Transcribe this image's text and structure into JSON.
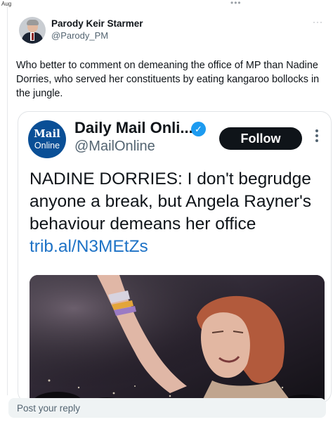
{
  "top_bar": {
    "date": "Aug",
    "more": "•••"
  },
  "tweet": {
    "author_name": "Parody Keir Starmer",
    "author_handle": "@Parody_PM",
    "text": "Who better to comment on demeaning the office of MP than Nadine Dorries, who served her constituents by eating kangaroo bollocks in the jungle.",
    "more": "···"
  },
  "quote": {
    "logo_line1": "Mail",
    "logo_line2": "Online",
    "name": "Daily Mail Onli...",
    "handle": "@MailOnline",
    "verified_glyph": "✓",
    "follow_label": "Follow",
    "headline": "NADINE DORRIES: I don't begrudge anyone a break, but Angela Rayner's behaviour demeans her office ",
    "link": "trib.al/N3MEtZs",
    "media_icon": "photo-crowd-image"
  },
  "reply": {
    "placeholder": "Post your reply"
  },
  "colors": {
    "accent": "#1d9bf0",
    "link": "#1d72c6",
    "mail_blue": "#0a4f96",
    "follow_bg": "#0f1419"
  }
}
